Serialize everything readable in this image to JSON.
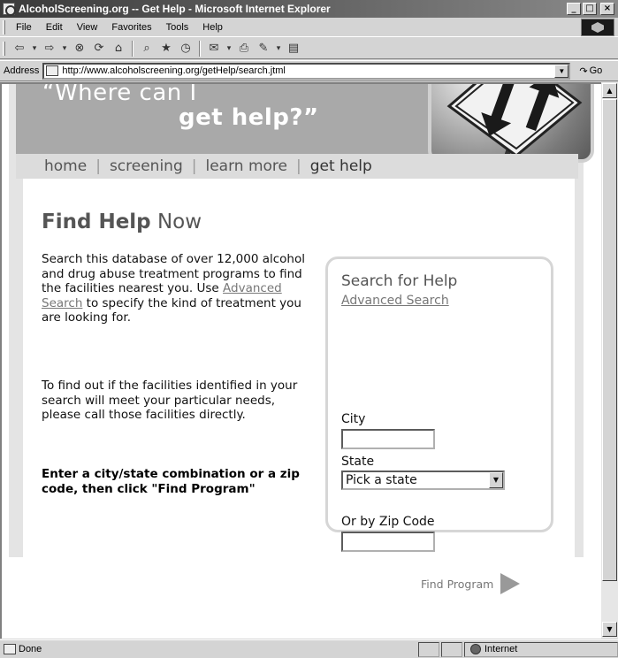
{
  "window": {
    "title": "AlcoholScreening.org -- Get Help - Microsoft Internet Explorer",
    "buttons": {
      "minimize": "_",
      "maximize": "□",
      "close": "×"
    }
  },
  "menu": [
    "File",
    "Edit",
    "View",
    "Favorites",
    "Tools",
    "Help"
  ],
  "address": {
    "label": "Address",
    "url": "http://www.alcoholscreening.org/getHelp/search.jtml",
    "go": "Go"
  },
  "banner": {
    "line1": "“Where can I",
    "line2": "get help?”"
  },
  "nav": {
    "items": [
      "home",
      "screening",
      "learn more",
      "get help"
    ],
    "separator": "|"
  },
  "heading": {
    "bold": "Find Help",
    "rest": " Now"
  },
  "intro": {
    "before": "Search this database of over 12,000 alcohol and drug abuse treatment programs to find the facilities nearest you. Use ",
    "link": "Advanced Search",
    "after": " to specify the kind of treatment you are looking for."
  },
  "para2": "To find out if the facilities identified in your search will meet your particular needs, please call those facilities directly.",
  "instructions": "Enter a city/state combination or a zip code, then click \"Find Program\"",
  "search": {
    "title": "Search for Help",
    "advanced_link": "Advanced Search",
    "city_label": "City",
    "city_value": "",
    "state_label": "State",
    "state_value": "Pick a state",
    "zip_label": "Or by Zip Code",
    "zip_value": "",
    "find_button": "Find Program"
  },
  "status": {
    "text": "Done",
    "zone": "Internet"
  }
}
